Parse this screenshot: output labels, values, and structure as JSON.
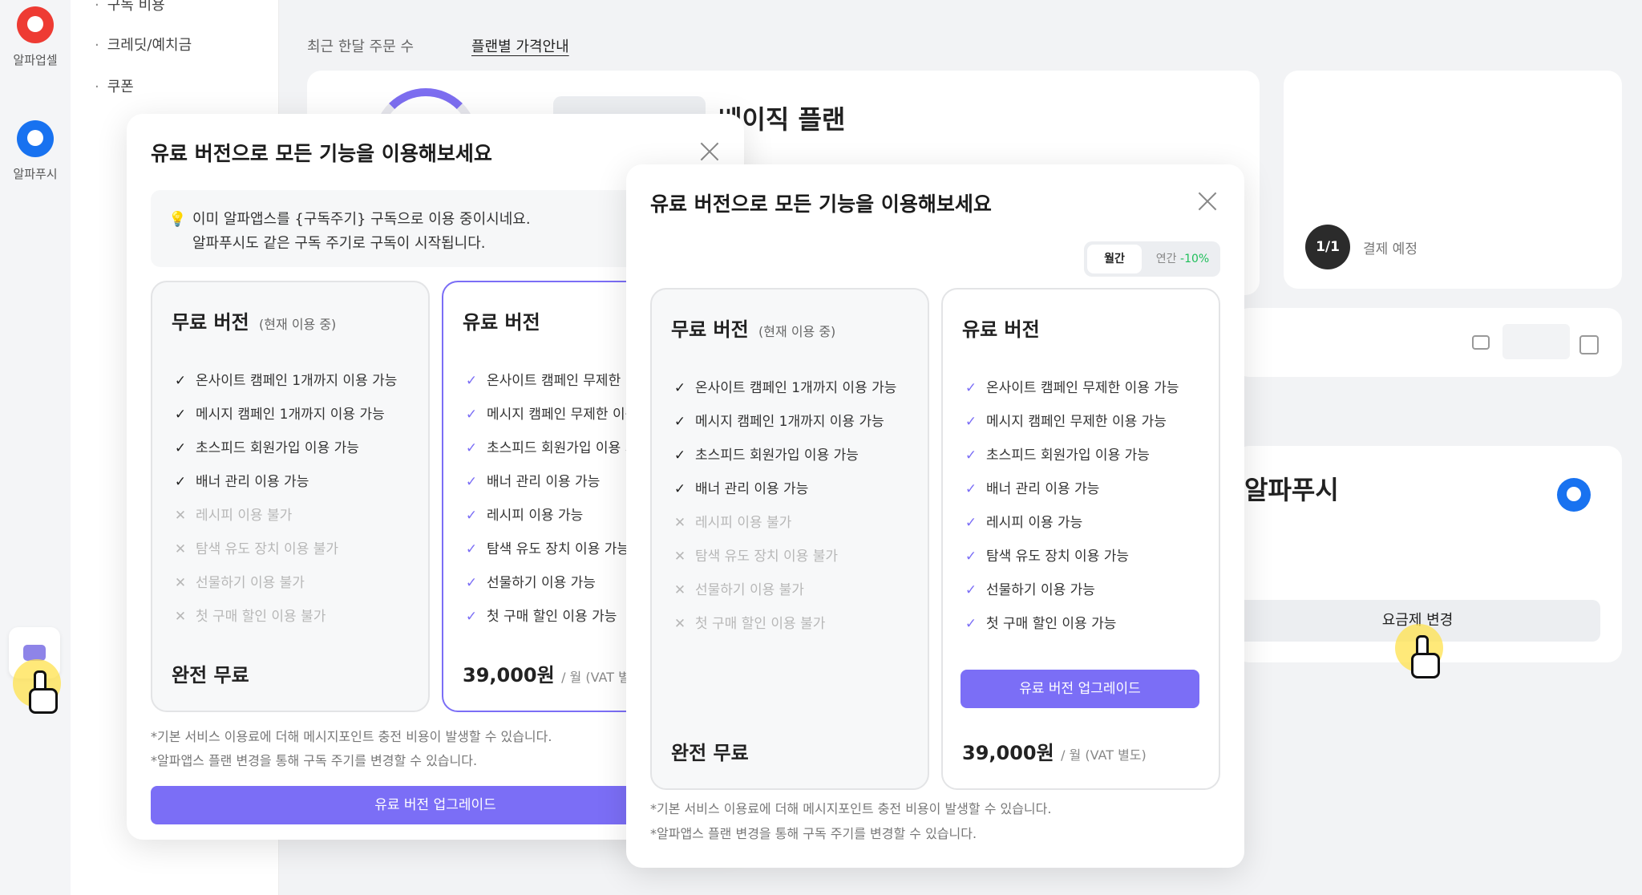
{
  "rail": {
    "apps": [
      {
        "name": "알파업셀",
        "icon": "alpha-upsell-logo"
      },
      {
        "name": "알파푸시",
        "icon": "alpha-push-logo"
      }
    ]
  },
  "sidemenu": {
    "items": [
      "구독 비용",
      "크레딧/예치금",
      "쿠폰"
    ]
  },
  "main": {
    "tabs": [
      "최근 한달 주문 수",
      "플랜별 가격안내"
    ],
    "plan_title": "베이직 플랜",
    "billing_count": "1/1",
    "billing_status": "결제 예정",
    "app_title": "알파푸시",
    "change_plan_label": "요금제 변경"
  },
  "modal_back": {
    "title": "유료 버전으로 모든 기능을 이용해보세요",
    "notice_line1": "이미 알파앱스를 {구독주기} 구독으로 이용 중이시네요.",
    "notice_line2": "알파푸시도 같은 구독 주기로 구독이 시작됩니다.",
    "free": {
      "title": "무료 버전",
      "subtitle": "(현재 이용 중)",
      "features": [
        {
          "text": "온사이트 캠페인 1개까지 이용 가능",
          "ok": true
        },
        {
          "text": "메시지 캠페인 1개까지 이용 가능",
          "ok": true
        },
        {
          "text": "초스피드 회원가입 이용 가능",
          "ok": true
        },
        {
          "text": "배너 관리 이용 가능",
          "ok": true
        },
        {
          "text": "레시피 이용 불가",
          "ok": false
        },
        {
          "text": "탐색 유도 장치 이용 불가",
          "ok": false
        },
        {
          "text": "선물하기 이용 불가",
          "ok": false
        },
        {
          "text": "첫 구매 할인 이용 불가",
          "ok": false
        }
      ],
      "price": "완전 무료"
    },
    "paid": {
      "title": "유료 버전",
      "features": [
        "온사이트 캠페인 무제한 이용 가능",
        "메시지 캠페인 무제한 이용 가능",
        "초스피드 회원가입 이용 가능",
        "배너 관리 이용 가능",
        "레시피 이용 가능",
        "탐색 유도 장치 이용 가능",
        "선물하기 이용 가능",
        "첫 구매 할인 이용 가능"
      ],
      "price": "39,000원",
      "price_unit": "/ 월 (VAT 별도)"
    },
    "note1": "*기본 서비스 이용료에 더해 메시지포인트 충전 비용이 발생할 수 있습니다.",
    "note2": "*알파앱스 플랜 변경을 통해 구독 주기를 변경할 수 있습니다.",
    "upgrade_label": "유료 버전 업그레이드"
  },
  "modal_front": {
    "title": "유료 버전으로 모든 기능을 이용해보세요",
    "toggle_monthly": "월간",
    "toggle_yearly": "연간",
    "toggle_discount": "-10%",
    "free": {
      "title": "무료 버전",
      "subtitle": "(현재 이용 중)",
      "features": [
        {
          "text": "온사이트 캠페인 1개까지 이용 가능",
          "ok": true
        },
        {
          "text": "메시지 캠페인 1개까지 이용 가능",
          "ok": true
        },
        {
          "text": "초스피드 회원가입 이용 가능",
          "ok": true
        },
        {
          "text": "배너 관리 이용 가능",
          "ok": true
        },
        {
          "text": "레시피 이용 불가",
          "ok": false
        },
        {
          "text": "탐색 유도 장치 이용 불가",
          "ok": false
        },
        {
          "text": "선물하기 이용 불가",
          "ok": false
        },
        {
          "text": "첫 구매 할인 이용 불가",
          "ok": false
        }
      ],
      "price": "완전 무료"
    },
    "paid": {
      "title": "유료 버전",
      "features": [
        "온사이트 캠페인 무제한 이용 가능",
        "메시지 캠페인 무제한 이용 가능",
        "초스피드 회원가입 이용 가능",
        "배너 관리 이용 가능",
        "레시피 이용 가능",
        "탐색 유도 장치 이용 가능",
        "선물하기 이용 가능",
        "첫 구매 할인 이용 가능"
      ],
      "price": "39,000원",
      "price_unit": "/ 월 (VAT 별도)",
      "upgrade_label": "유료 버전 업그레이드"
    },
    "note1": "*기본 서비스 이용료에 더해 메시지포인트 충전 비용이 발생할 수 있습니다.",
    "note2": "*알파앱스 플랜 변경을 통해 구독 주기를 변경할 수 있습니다."
  },
  "colors": {
    "accent": "#7b6ef6",
    "discount": "#1fbf5a",
    "alpha_upsell": "#ee3b33",
    "alpha_push": "#1872f0"
  }
}
